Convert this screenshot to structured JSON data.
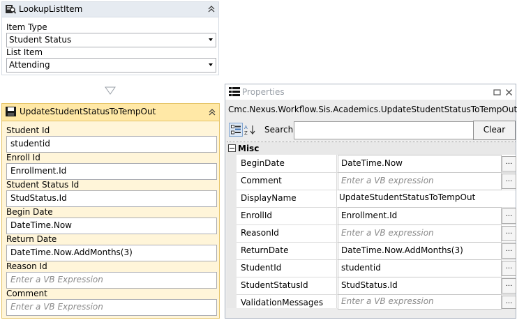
{
  "lookup": {
    "title": "LookupListItem",
    "item_type_label": "Item Type",
    "item_type_value": "Student Status",
    "list_item_label": "List Item",
    "list_item_value": "Attending"
  },
  "update": {
    "title": "UpdateStudentStatusToTempOut",
    "fields": [
      {
        "label": "Student Id",
        "value": "studentid",
        "placeholder": false
      },
      {
        "label": "Enroll Id",
        "value": "Enrollment.Id",
        "placeholder": false
      },
      {
        "label": "Student Status Id",
        "value": "StudStatus.Id",
        "placeholder": false
      },
      {
        "label": "Begin Date",
        "value": "DateTime.Now",
        "placeholder": false
      },
      {
        "label": "Return Date",
        "value": "DateTime.Now.AddMonths(3)",
        "placeholder": false
      },
      {
        "label": "Reason Id",
        "value": "Enter a VB Expression",
        "placeholder": true
      },
      {
        "label": "Comment",
        "value": "Enter a VB Expression",
        "placeholder": true
      }
    ]
  },
  "properties": {
    "title": "Properties",
    "object_name": "Cmc.Nexus.Workflow.Sis.Academics.UpdateStudentStatusToTempOut",
    "search_label": "Search:",
    "search_value": "",
    "clear_label": "Clear",
    "category": "Misc",
    "dots_label": "...",
    "rows": [
      {
        "name": "BeginDate",
        "value": "DateTime.Now",
        "placeholder": false,
        "editor": true
      },
      {
        "name": "Comment",
        "value": "Enter a VB expression",
        "placeholder": true,
        "editor": true
      },
      {
        "name": "DisplayName",
        "value": "UpdateStudentStatusToTempOut",
        "placeholder": false,
        "editor": false
      },
      {
        "name": "EnrollId",
        "value": "Enrollment.Id",
        "placeholder": false,
        "editor": true
      },
      {
        "name": "ReasonId",
        "value": "Enter a VB expression",
        "placeholder": true,
        "editor": true
      },
      {
        "name": "ReturnDate",
        "value": "DateTime.Now.AddMonths(3)",
        "placeholder": false,
        "editor": true
      },
      {
        "name": "StudentId",
        "value": "studentid",
        "placeholder": false,
        "editor": true
      },
      {
        "name": "StudentStatusId",
        "value": "StudStatus.Id",
        "placeholder": false,
        "editor": true
      },
      {
        "name": "ValidationMessages",
        "value": "Enter a VB expression",
        "placeholder": true,
        "editor": true
      }
    ]
  },
  "colors": {
    "selected_header": "#ffe8a6",
    "selected_border": "#e5c365",
    "header": "#e6ebf1"
  }
}
